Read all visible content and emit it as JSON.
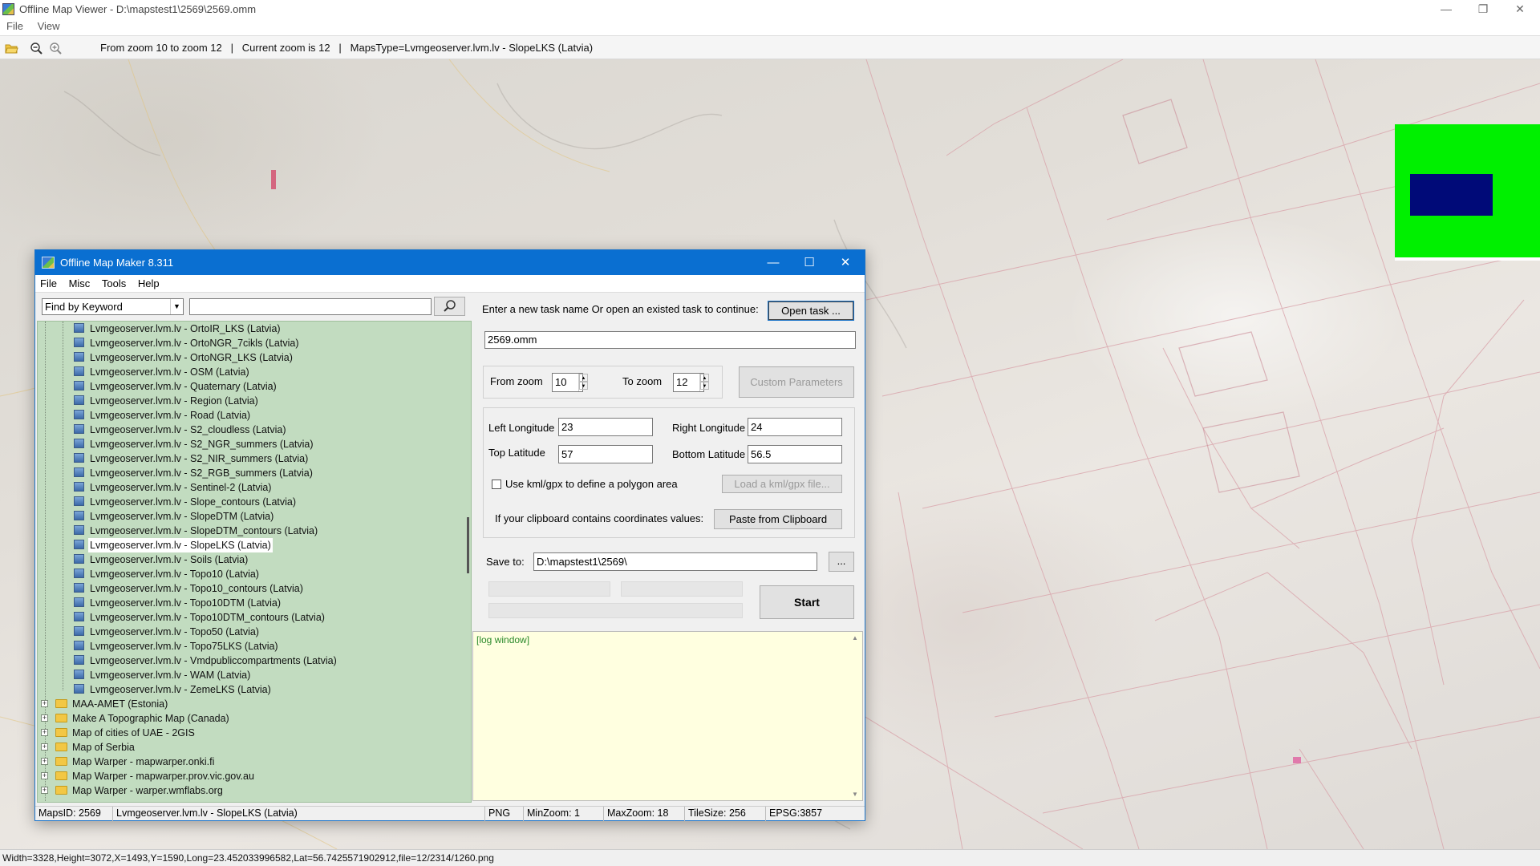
{
  "window": {
    "title": "Offline Map Viewer - D:\\mapstest1\\2569\\2569.omm",
    "menu": [
      "File",
      "View"
    ]
  },
  "toolbar": {
    "status": "From zoom 10 to zoom 12   |   Current zoom is 12   |   MapsType=Lvmgeoserver.lvm.lv - SlopeLKS (Latvia)"
  },
  "bottom_status": "Width=3328,Height=3072,X=1493,Y=1590,Long=23.452033996582,Lat=56.7425571902912,file=12/2314/1260.png",
  "dialog": {
    "title": "Offline Map Maker 8.311",
    "menu": [
      "File",
      "Misc",
      "Tools",
      "Help"
    ],
    "search": {
      "mode": "Find by Keyword",
      "keyword": ""
    },
    "tree": {
      "map_items": [
        "Lvmgeoserver.lvm.lv - OrtoIR_LKS (Latvia)",
        "Lvmgeoserver.lvm.lv - OrtoNGR_7cikls (Latvia)",
        "Lvmgeoserver.lvm.lv - OrtoNGR_LKS (Latvia)",
        "Lvmgeoserver.lvm.lv - OSM (Latvia)",
        "Lvmgeoserver.lvm.lv - Quaternary (Latvia)",
        "Lvmgeoserver.lvm.lv - Region (Latvia)",
        "Lvmgeoserver.lvm.lv - Road (Latvia)",
        "Lvmgeoserver.lvm.lv - S2_cloudless (Latvia)",
        "Lvmgeoserver.lvm.lv - S2_NGR_summers (Latvia)",
        "Lvmgeoserver.lvm.lv - S2_NIR_summers (Latvia)",
        "Lvmgeoserver.lvm.lv - S2_RGB_summers (Latvia)",
        "Lvmgeoserver.lvm.lv - Sentinel-2 (Latvia)",
        "Lvmgeoserver.lvm.lv - Slope_contours (Latvia)",
        "Lvmgeoserver.lvm.lv - SlopeDTM (Latvia)",
        "Lvmgeoserver.lvm.lv - SlopeDTM_contours (Latvia)",
        "Lvmgeoserver.lvm.lv - SlopeLKS (Latvia)",
        "Lvmgeoserver.lvm.lv - Soils (Latvia)",
        "Lvmgeoserver.lvm.lv - Topo10 (Latvia)",
        "Lvmgeoserver.lvm.lv - Topo10_contours (Latvia)",
        "Lvmgeoserver.lvm.lv - Topo10DTM (Latvia)",
        "Lvmgeoserver.lvm.lv - Topo10DTM_contours (Latvia)",
        "Lvmgeoserver.lvm.lv - Topo50 (Latvia)",
        "Lvmgeoserver.lvm.lv - Topo75LKS (Latvia)",
        "Lvmgeoserver.lvm.lv - Vmdpubliccompartments (Latvia)",
        "Lvmgeoserver.lvm.lv - WAM (Latvia)",
        "Lvmgeoserver.lvm.lv - ZemeLKS (Latvia)"
      ],
      "selected": "Lvmgeoserver.lvm.lv - SlopeLKS (Latvia)",
      "folders": [
        "MAA-AMET (Estonia)",
        "Make A Topographic Map (Canada)",
        "Map of cities of UAE - 2GIS",
        "Map of Serbia",
        "Map Warper - mapwarper.onki.fi",
        "Map Warper - mapwarper.prov.vic.gov.au",
        "Map Warper - warper.wmflabs.org"
      ]
    },
    "task": {
      "prompt": "Enter a new task name Or open an existed task to continue:",
      "open_button": "Open task ...",
      "name": "2569.omm"
    },
    "zoom": {
      "from_label": "From zoom",
      "from_value": "10",
      "to_label": "To zoom",
      "to_value": "12",
      "custom_button": "Custom Parameters"
    },
    "bounds": {
      "left_lon_label": "Left Longitude",
      "left_lon": "23",
      "right_lon_label": "Right Longitude",
      "right_lon": "24",
      "top_lat_label": "Top Latitude",
      "top_lat": "57",
      "bottom_lat_label": "Bottom Latitude",
      "bottom_lat": "56.5",
      "kml_checkbox": "Use kml/gpx to define a polygon area",
      "kml_checked": false,
      "load_kml_button": "Load a kml/gpx file...",
      "clipboard_label": "If your clipboard contains coordinates values:",
      "paste_button": "Paste from Clipboard"
    },
    "save": {
      "label": "Save to:",
      "path": "D:\\mapstest1\\2569\\",
      "browse_button": "..."
    },
    "start_button": "Start",
    "log": "[log window]",
    "status": {
      "maps_id": "MapsID: 2569",
      "map_name": "Lvmgeoserver.lvm.lv - SlopeLKS (Latvia)",
      "format": "PNG",
      "min_zoom": "MinZoom: 1",
      "max_zoom": "MaxZoom: 18",
      "tile_size": "TileSize: 256",
      "epsg": "EPSG:3857"
    }
  },
  "colors": {
    "dialog_title_bg": "#0a6fd1",
    "tree_bg": "#c2dcc0",
    "log_bg": "#ffffe0",
    "minimap_green": "#00f000",
    "minimap_blue": "#000a78"
  }
}
